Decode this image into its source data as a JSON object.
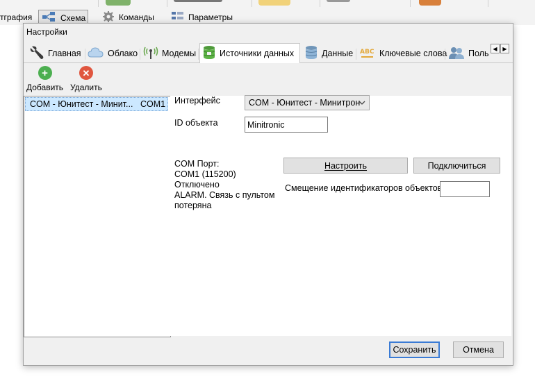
{
  "background_app": {
    "tabs": [
      {
        "label": "тграфия"
      },
      {
        "label": "Схема"
      },
      {
        "label": "Команды"
      },
      {
        "label": "Параметры"
      }
    ]
  },
  "dialog": {
    "title": "Настройки",
    "tabs": [
      {
        "label": "Главная",
        "icon": "wrench-icon"
      },
      {
        "label": "Облако",
        "icon": "cloud-icon"
      },
      {
        "label": "Модемы",
        "icon": "antenna-icon"
      },
      {
        "label": "Источники данных",
        "icon": "database-plug-icon",
        "active": true
      },
      {
        "label": "Данные",
        "icon": "database-icon"
      },
      {
        "label": "Ключевые слова",
        "icon": "keywords-icon"
      },
      {
        "label": "Поль",
        "icon": "users-icon"
      }
    ],
    "toolbar": {
      "add_label": "Добавить",
      "delete_label": "Удалить"
    },
    "sources": [
      {
        "name": "COM - Юнитест - Минит...",
        "port": "COM1"
      }
    ],
    "detail": {
      "interface_label": "Интерфейс",
      "interface_value": "COM - Юнитест - Минитрон",
      "object_id_label": "ID объекта",
      "object_id_value": "Minitronic",
      "status_lines": [
        "COM Порт:",
        "COM1 (115200)",
        "Отключено",
        "ALARM. Связь с пультом",
        "потеряна"
      ],
      "configure_button": "Настроить",
      "connect_button": "Подключиться",
      "offset_label": "Смещение идентификаторов объектов",
      "offset_value": ""
    },
    "save_button": "Сохранить",
    "cancel_button": "Отмена"
  },
  "colors": {
    "accent": "#3a7bd5",
    "selection": "#cce8ff",
    "add_green": "#4caf50",
    "delete_red": "#e0563f"
  }
}
